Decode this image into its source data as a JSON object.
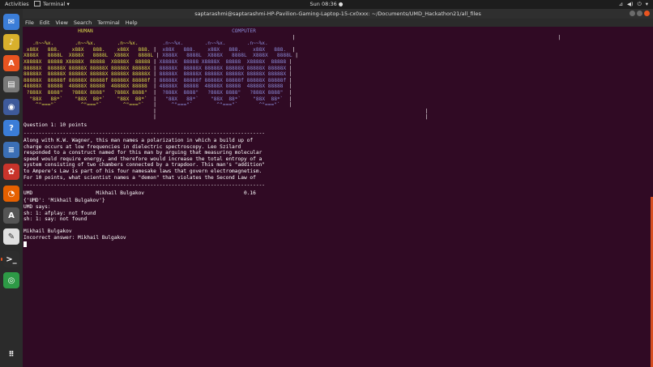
{
  "topbar": {
    "activities": "Activities",
    "app_name": "Terminal ▾",
    "clock": "Sun 08:36 ●",
    "tray_icons": [
      "network-icon",
      "volume-icon",
      "power-icon",
      "chevron-down-icon"
    ]
  },
  "window": {
    "title": "saptarashmi@saptarashmi-HP-Pavilion-Gaming-Laptop-15-cx0xxx: ~/Documents/UMD_Hackathon21/all_files"
  },
  "menu": [
    "File",
    "Edit",
    "View",
    "Search",
    "Terminal",
    "Help"
  ],
  "dock": [
    {
      "name": "thunderbird-icon",
      "color": "#3b7dd8",
      "glyph": "✉"
    },
    {
      "name": "rhythmbox-icon",
      "color": "#d8b02c",
      "glyph": "♪"
    },
    {
      "name": "software-center-icon",
      "color": "#e95420",
      "glyph": "A"
    },
    {
      "name": "files-icon",
      "color": "#7a7a7a",
      "glyph": "▤"
    },
    {
      "name": "disk-icon",
      "color": "#3e5a9a",
      "glyph": "◉"
    },
    {
      "name": "help-icon",
      "color": "#3b7dd8",
      "glyph": "?"
    },
    {
      "name": "writer-icon",
      "color": "#3b6fb6",
      "glyph": "≡"
    },
    {
      "name": "ubuntu-one-icon",
      "color": "#c8342b",
      "glyph": "✿"
    },
    {
      "name": "firefox-icon",
      "color": "#e66000",
      "glyph": "◔"
    },
    {
      "name": "updater-icon",
      "color": "#555555",
      "glyph": "A"
    },
    {
      "name": "text-editor-icon",
      "color": "#e0e0e0",
      "glyph": "✎"
    },
    {
      "name": "terminal-icon",
      "color": "#2d2d2d",
      "glyph": ">_"
    },
    {
      "name": "chrome-icon",
      "color": "#2d9a46",
      "glyph": "◎"
    }
  ],
  "apps_grid_icon": "apps-grid-icon",
  "terminal": {
    "banner_labels": [
      "HUMAN",
      "COMPUTER"
    ],
    "question_header": "Question 1: 10 points",
    "question_lines": [
      "Along with K.W. Wagner, this man names a polarization in which a build up of",
      "charge occurs at low frequencies in dielectric spectroscopy. Leo Szilard",
      "responded to a construct named for this man by arguing that measuring molecular",
      "speed would require energy, and therefore would increase the total entropy of a",
      "system consisting of two chambers connected by a trapdoor. This man's \"addition\"",
      "to Ampere's Law is part of his four namesake laws that govern electromagnetism.",
      "For 10 points, what scientist names a \"demon\" that violates the Second Law of"
    ],
    "score_line": {
      "team": "UMD",
      "answer": "Mikhail Bulgakov",
      "score": "0.16"
    },
    "output_lines": [
      "{'UMD': 'Mikhail Bulgakov'}",
      "UMD says:",
      "sh: 1: afplay: not found",
      "sh: 1: say: not found",
      "",
      "Mikhail Bulgakov",
      "Incorrect answer: Mikhail Bulgakov"
    ]
  }
}
